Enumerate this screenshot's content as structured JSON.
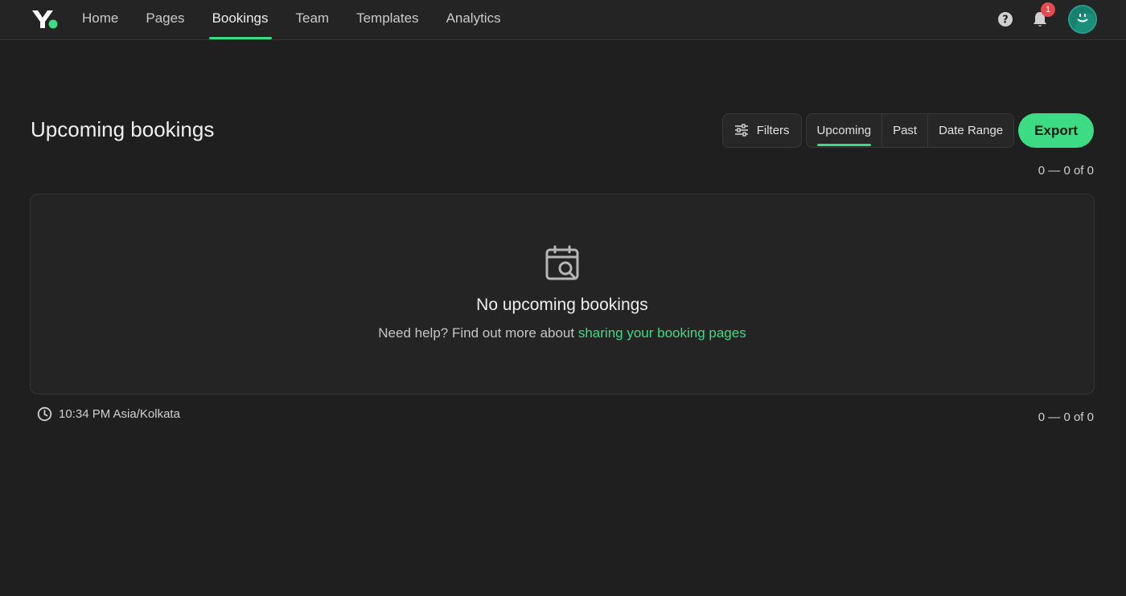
{
  "nav": {
    "items": [
      {
        "label": "Home",
        "active": false
      },
      {
        "label": "Pages",
        "active": false
      },
      {
        "label": "Bookings",
        "active": true
      },
      {
        "label": "Team",
        "active": false
      },
      {
        "label": "Templates",
        "active": false
      },
      {
        "label": "Analytics",
        "active": false
      }
    ],
    "notifications_count": "1",
    "icons": [
      "help-icon",
      "bell-icon",
      "avatar"
    ]
  },
  "page": {
    "title": "Upcoming bookings",
    "filters_label": "Filters",
    "tabs": [
      {
        "label": "Upcoming",
        "active": true
      },
      {
        "label": "Past",
        "active": false
      },
      {
        "label": "Date Range",
        "active": false
      }
    ],
    "export_label": "Export",
    "pagination_top": "0 — 0 of 0",
    "pagination_bottom": "0 — 0 of 0"
  },
  "empty_state": {
    "icon": "calendar-search-icon",
    "title": "No upcoming bookings",
    "help_prefix": "Need help? Find out more about ",
    "help_link": "sharing your booking pages"
  },
  "footer": {
    "timezone": "10:34 PM Asia/Kolkata",
    "icon": "clock-icon"
  },
  "colors": {
    "accent": "#3ddc84",
    "background": "#1e1f1e",
    "badge": "#e5484d"
  }
}
